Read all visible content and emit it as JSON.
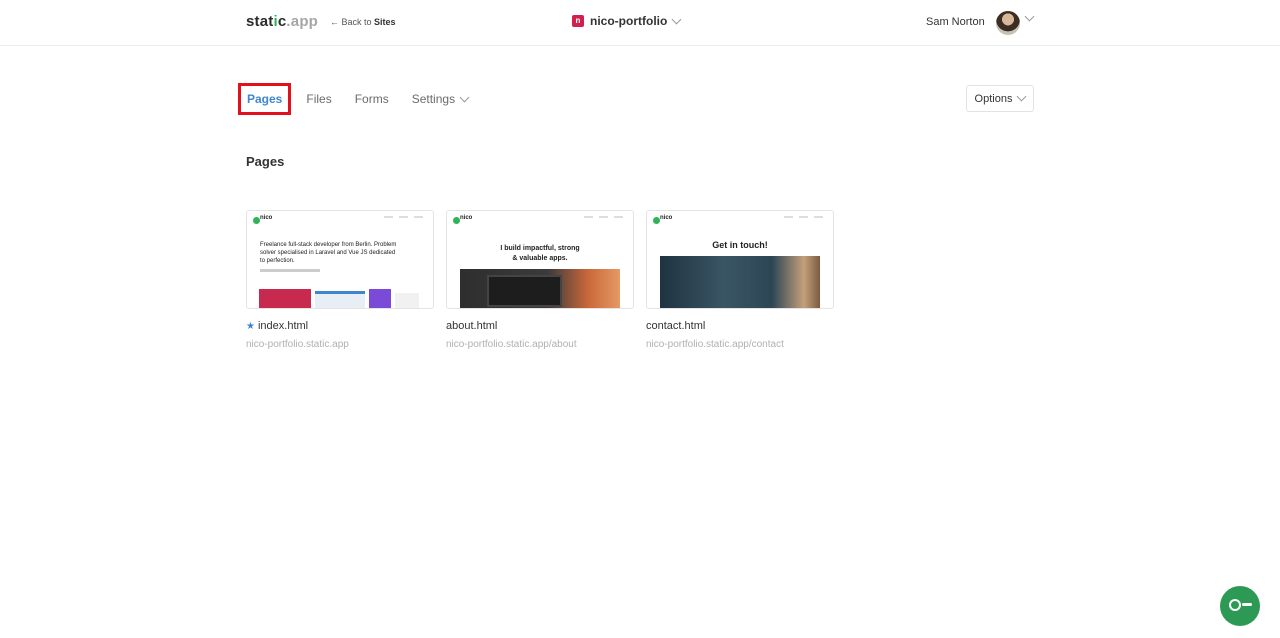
{
  "header": {
    "logo_part1": "stat",
    "logo_accent": "i",
    "logo_part2": "c",
    "logo_domain": ".app",
    "back_prefix": "← Back to ",
    "back_label": "Sites",
    "site_icon_letter": "n",
    "site_name": "nico-portfolio",
    "user_name": "Sam Norton"
  },
  "tabs": [
    {
      "label": "Pages",
      "active": true
    },
    {
      "label": "Files"
    },
    {
      "label": "Forms"
    },
    {
      "label": "Settings"
    }
  ],
  "options_label": "Options",
  "section_title": "Pages",
  "pages": [
    {
      "name": "index.html",
      "starred": true,
      "url": "nico-portfolio.static.app",
      "thumb_brand": "nico",
      "thumb_text": "Freelance full-stack developer from Berlin. Problem solver specialised in Laravel and Vue JS dedicated to perfection."
    },
    {
      "name": "about.html",
      "url": "nico-portfolio.static.app/about",
      "thumb_brand": "nico",
      "thumb_text": "I build impactful, strong & valuable apps."
    },
    {
      "name": "contact.html",
      "url": "nico-portfolio.static.app/contact",
      "thumb_brand": "nico",
      "thumb_text": "Get in touch!"
    }
  ],
  "colors": {
    "accent": "#3f86d1",
    "highlight_box": "#e3101c",
    "fab": "#2c9a55",
    "site_icon": "#d0204e"
  }
}
